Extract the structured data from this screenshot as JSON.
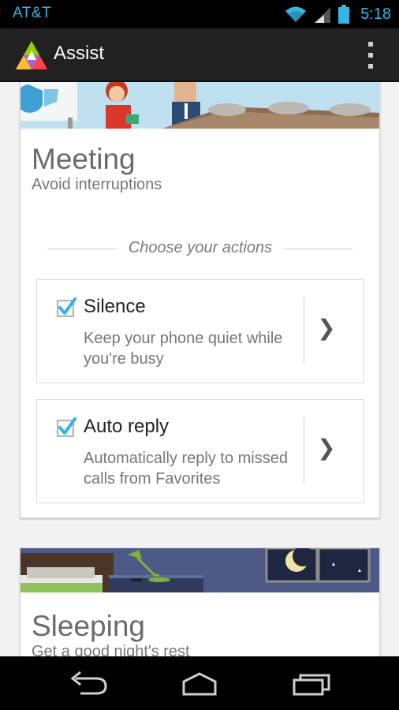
{
  "status_bar": {
    "carrier": "AT&T",
    "time": "5:18",
    "icons": [
      "wifi-icon",
      "signal-icon",
      "battery-icon"
    ],
    "accent_color": "#33b5e5"
  },
  "action_bar": {
    "title": "Assist",
    "logo_icon": "assist-triangle-logo",
    "overflow_icon": "overflow-menu-icon",
    "background": "#212121"
  },
  "cards": [
    {
      "title": "Meeting",
      "subtitle": "Avoid interruptions",
      "banner": "meeting-illustration",
      "section_label": "Choose your actions",
      "actions": [
        {
          "title": "Silence",
          "description": "Keep your phone quiet while you're busy",
          "checked": true
        },
        {
          "title": "Auto reply",
          "description": "Automatically reply to missed calls from Favorites",
          "checked": true
        }
      ]
    },
    {
      "title": "Sleeping",
      "subtitle": "Get a good night's rest",
      "banner": "bedroom-night-illustration"
    }
  ],
  "nav_bar": {
    "buttons": [
      "back-icon",
      "home-icon",
      "recents-icon"
    ]
  },
  "colors": {
    "checkbox_check": "#33b5e5",
    "page_background": "#f2f2f2"
  }
}
